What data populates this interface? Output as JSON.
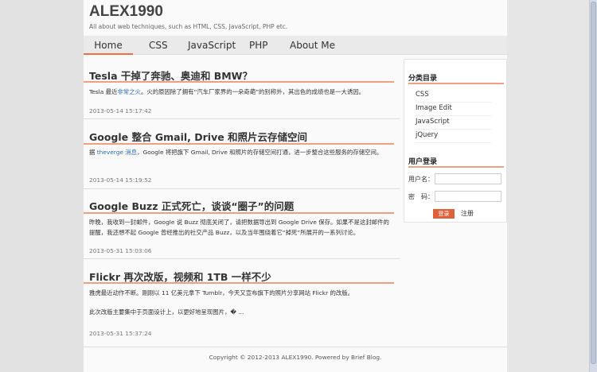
{
  "header": {
    "title": "ALEX1990",
    "description": "All about web techniques, such as HTML, CSS, JavaScript, PHP etc."
  },
  "nav": [
    "Home",
    "CSS",
    "JavaScript",
    "PHP",
    "About Me"
  ],
  "posts": [
    {
      "title": "Tesla 干掉了奔驰、奥迪和 BMW？",
      "body": [
        "Tesla 最近",
        "非常之火",
        "。火的原因除了拥有“汽车厂家界的一朵奇葩”的别称外，其出色的成绩也是一大诱因。"
      ],
      "date": "2013-05-14 15:17:42"
    },
    {
      "title": "Google 整合 Gmail, Drive 和照片云存储空间",
      "body": [
        "据 ",
        "theverge 消息",
        "，Google 将把旗下 Gmail, Drive 和照片的存储空间打通，进一步整合这些服务的存储空间。"
      ],
      "date": "2013-05-14 15:19:52"
    },
    {
      "title": "Google Buzz 正式死亡，谈谈“圈子”的问题",
      "body": [
        "昨晚，我收到一封邮件，Google 说 Buzz 彻底关闭了，请把数据导出到 Google Drive 保存。如果不是这封邮件的提醒，我还想不起 Google 曾经推出的社交产品 Buzz，以及当年围绕着它“掉死”所展开的一系列讨论。"
      ],
      "date": "2013-05-31 15:03:06"
    },
    {
      "title": "Flickr 再次改版，视频和 1TB 一样不少",
      "body": [
        "雅虎最近动作不断。刚刚以 11 亿美元拿下 Tumblr，今天又宣布旗下的照片分享网站 Flickr 的改版。",
        "此次改版主要集中于页面设计上，以更好地呈现图片，� ..."
      ],
      "date": "2013-05-31 15:37:24"
    }
  ],
  "sidebar": {
    "categories_title": "分类目录",
    "categories": [
      "CSS",
      "Image Edit",
      "JavaScript",
      "jQuery"
    ],
    "login_title": "用户登录",
    "username_label": "用户名：",
    "password_label": "密　码：",
    "login_button": "登录",
    "register_link": "注册"
  },
  "footer": "Copyright © 2012-2013 ALEX1990. Powered by Brief Blog.",
  "colors": {
    "accent": "#e8734a",
    "link": "#2a6db8"
  }
}
